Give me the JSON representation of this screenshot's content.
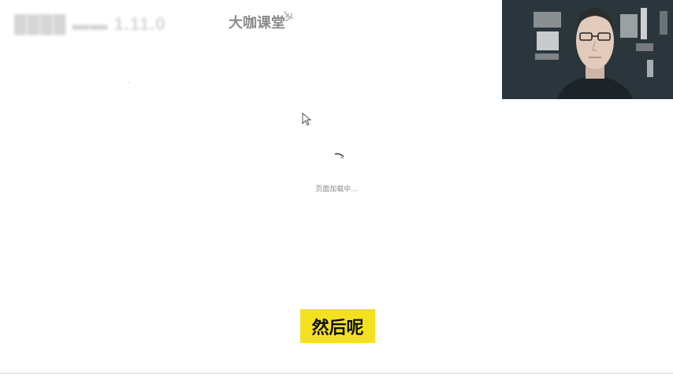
{
  "header": {
    "version_text": "████ ▬▬ 1.11.0",
    "logo_text": "大咖课堂",
    "logo_icon": "signal-waves-icon"
  },
  "webcam": {
    "icon": "presenter-video-icon"
  },
  "pointer": {
    "icon": "mouse-pointer-icon"
  },
  "loader": {
    "icon": "spinner-icon",
    "text": "页面加载中..."
  },
  "caption": {
    "text": "然后呢",
    "background": "#f3e021"
  }
}
